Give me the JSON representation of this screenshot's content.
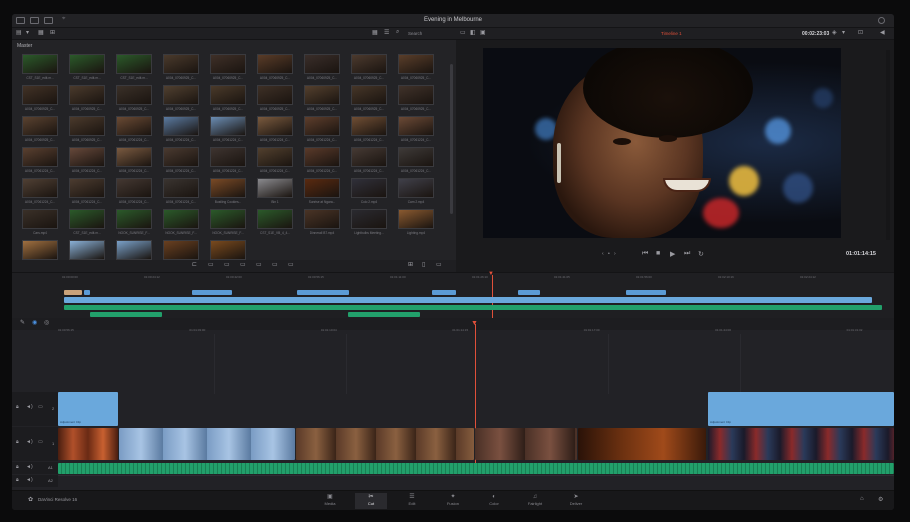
{
  "window": {
    "title": "Evening in Melbourne"
  },
  "media_pool": {
    "label": "Master",
    "search_label": "Search",
    "thumbs": [
      {
        "cap": "CST_S1E_edit.m...",
        "color": "#2b5a2a"
      },
      {
        "cap": "CST_S1E_edit.m...",
        "color": "#2b5a2a"
      },
      {
        "cap": "CST_S1E_edit.m...",
        "color": "#2b5a2a"
      },
      {
        "cap": "A004_07060925_C...",
        "color": "#4a3a2c"
      },
      {
        "cap": "A004_07060925_C...",
        "color": "#3f3028"
      },
      {
        "cap": "A004_07060925_C...",
        "color": "#5a3c28"
      },
      {
        "cap": "A004_07060925_C...",
        "color": "#3a2e2a"
      },
      {
        "cap": "A004_07060925_C...",
        "color": "#4c3a2e"
      },
      {
        "cap": "A004_07060925_C...",
        "color": "#5a3e2a"
      },
      {
        "cap": "A004_07060925_C...",
        "color": "#423226"
      },
      {
        "cap": "A004_07060925_C...",
        "color": "#4a3a2c"
      },
      {
        "cap": "A004_07060925_C...",
        "color": "#3a3028"
      },
      {
        "cap": "A004_07060925_C...",
        "color": "#504030"
      },
      {
        "cap": "A004_07060925_C...",
        "color": "#4a3a2a"
      },
      {
        "cap": "A004_07060925_C...",
        "color": "#3e3026"
      },
      {
        "cap": "A004_07060925_C...",
        "color": "#54402e"
      },
      {
        "cap": "A004_07060925_C...",
        "color": "#463628"
      },
      {
        "cap": "A004_07060925_C...",
        "color": "#40322a"
      },
      {
        "cap": "A004_07060925_C...",
        "color": "#5a4230"
      },
      {
        "cap": "A004_07060925_C...",
        "color": "#4b3a2c"
      },
      {
        "cap": "A004_07061224_C...",
        "color": "#6a4a34"
      },
      {
        "cap": "A004_07061224_C...",
        "color": "#5a7aa0"
      },
      {
        "cap": "A004_07061224_C...",
        "color": "#6b8db3"
      },
      {
        "cap": "A004_07061224_C...",
        "color": "#7a5a3e"
      },
      {
        "cap": "A004_07061224_C...",
        "color": "#5e3e2c"
      },
      {
        "cap": "A004_07061224_C...",
        "color": "#704e34"
      },
      {
        "cap": "A004_07061224_C...",
        "color": "#6c4a36"
      },
      {
        "cap": "A004_07061224_C...",
        "color": "#5a4030"
      },
      {
        "cap": "A004_07061224_C...",
        "color": "#66483a"
      },
      {
        "cap": "A004_07061224_C...",
        "color": "#7a5a40"
      },
      {
        "cap": "A004_07061224_C...",
        "color": "#4a3a30"
      },
      {
        "cap": "A004_07061224_C...",
        "color": "#3e3430"
      },
      {
        "cap": "A004_07061224_C...",
        "color": "#52402e"
      },
      {
        "cap": "A004_07061224_C...",
        "color": "#5a3a2a"
      },
      {
        "cap": "A004_07061224_C...",
        "color": "#463a34"
      },
      {
        "cap": "A004_07061224_C...",
        "color": "#3e3a38"
      },
      {
        "cap": "A004_07061224_C...",
        "color": "#504034"
      },
      {
        "cap": "A004_07061224_C...",
        "color": "#4c3c30"
      },
      {
        "cap": "A004_07061224_C...",
        "color": "#443832"
      },
      {
        "cap": "A004_07061224_C...",
        "color": "#3a3430"
      },
      {
        "cap": "Bustling Cookies...",
        "color": "#7a4a26"
      },
      {
        "cap": "Bin 1",
        "color": "#8a8a8e"
      },
      {
        "cap": "Sunrise at Ngara...",
        "color": "#5a2a10"
      },
      {
        "cap": "Colo 2.mp4",
        "color": "#30303a"
      },
      {
        "cap": "Cam 2.mp4",
        "color": "#40404a"
      },
      {
        "cap": "Cars.mp4",
        "color": "#3a3028"
      },
      {
        "cap": "CST_S1E_edit.m...",
        "color": "#2b5a2a"
      },
      {
        "cap": "NOOK_SUNRISE_F...",
        "color": "#2b5a2a"
      },
      {
        "cap": "NOOK_SUNRISE_F...",
        "color": "#2b5a2a"
      },
      {
        "cap": "NOOK_SUNRISE_F...",
        "color": "#2b5a2a"
      },
      {
        "cap": "CST_S1E_VB_4_4...",
        "color": "#2b5a2a"
      },
      {
        "cap": "Dinnerall B7.mp4",
        "color": "#4a3426"
      },
      {
        "cap": "Lightbulbs Meeting...",
        "color": "#2a2a30"
      },
      {
        "cap": "Lighting.mp4",
        "color": "#8a5a30"
      },
      {
        "cap": "Moon Lighting B...",
        "color": "#a07040"
      },
      {
        "cap": "Overhead Lights...",
        "color": "#8ab0d6"
      },
      {
        "cap": "Overhead Lights...",
        "color": "#7aa0c8"
      },
      {
        "cap": "The Dinner.mp4",
        "color": "#6a4020"
      },
      {
        "cap": "The Sunset Cars a...",
        "color": "#7a4a1e"
      }
    ]
  },
  "viewer": {
    "timeline_name": "Timeline 1",
    "duration_tc": "00:02:23:03",
    "current_tc": "01:01:14:15"
  },
  "timeline": {
    "ruler_marks": [
      "01:00:00:00",
      "01:00:24:12",
      "01:00:42:00",
      "01:00:56:15",
      "01:01:11:00",
      "01:01:26:10",
      "01:01:41:05",
      "01:01:56:00",
      "01:02:10:16",
      "01:02:24:12"
    ],
    "main_marks": [
      "01:00:56:15",
      "01:01:03:00",
      "01:01:10:04",
      "01:01:14:15",
      "01:01:17:00",
      "01:01:24:00",
      "01:01:31:02"
    ],
    "tracks": [
      {
        "label": "V2",
        "num": "2"
      },
      {
        "label": "V1",
        "num": "1"
      },
      {
        "label": "A1",
        "num": "A1"
      },
      {
        "label": "A2",
        "num": "A2"
      }
    ],
    "clip_label_a": "Adjustment Clip",
    "clip_label_b": "Adjustment Clip"
  },
  "app_name": "DaVinci Resolve 16",
  "pages": [
    {
      "name": "Media",
      "icon": "▣"
    },
    {
      "name": "Cut",
      "icon": "✂"
    },
    {
      "name": "Edit",
      "icon": "☰"
    },
    {
      "name": "Fusion",
      "icon": "✦"
    },
    {
      "name": "Color",
      "icon": "◐"
    },
    {
      "name": "Fairlight",
      "icon": "♫"
    },
    {
      "name": "Deliver",
      "icon": "➤"
    }
  ],
  "colors": {
    "accent": "#e0503a",
    "clip_blue": "#5b9bd5",
    "audio_green": "#22a06b"
  }
}
